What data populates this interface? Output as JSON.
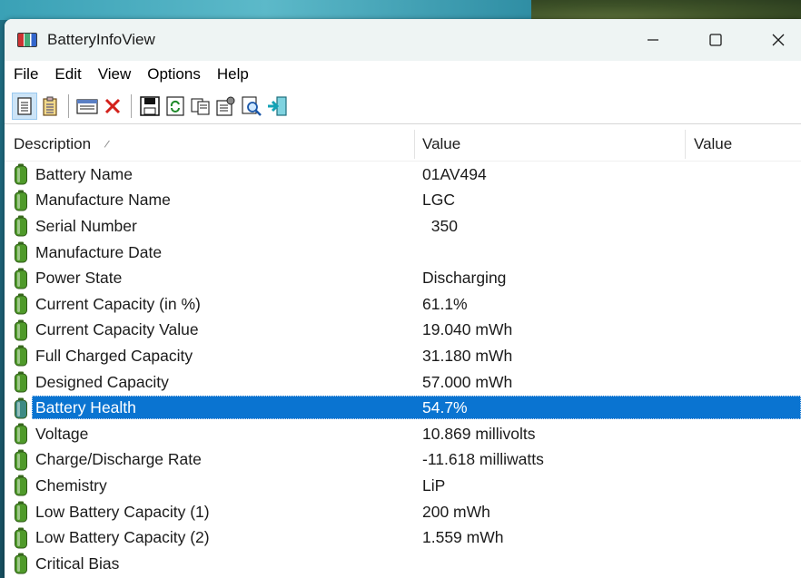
{
  "window": {
    "title": "BatteryInfoView",
    "icons": {
      "app": "battery-app-icon",
      "minimize": "minimize-icon",
      "maximize": "maximize-icon",
      "close": "close-icon"
    }
  },
  "menu": [
    "File",
    "Edit",
    "View",
    "Options",
    "Help"
  ],
  "toolbar": {
    "buttons": [
      "battery-info-mode-icon",
      "battery-log-mode-icon",
      "html-report-icon",
      "delete-icon",
      "save-icon",
      "refresh-icon",
      "copy-icon",
      "properties-icon",
      "find-icon",
      "exit-icon"
    ]
  },
  "columns": {
    "description": "Description",
    "value": "Value",
    "value2": "Value"
  },
  "rows": [
    {
      "description": "Battery Name",
      "value": "01AV494"
    },
    {
      "description": "Manufacture Name",
      "value": "LGC"
    },
    {
      "description": "Serial Number",
      "value": "  350"
    },
    {
      "description": "Manufacture Date",
      "value": ""
    },
    {
      "description": "Power State",
      "value": "Discharging"
    },
    {
      "description": "Current Capacity (in %)",
      "value": "61.1%"
    },
    {
      "description": "Current Capacity Value",
      "value": "19.040 mWh"
    },
    {
      "description": "Full Charged Capacity",
      "value": "31.180 mWh"
    },
    {
      "description": "Designed Capacity",
      "value": "57.000 mWh"
    },
    {
      "description": "Battery Health",
      "value": "54.7%",
      "selected": true
    },
    {
      "description": "Voltage",
      "value": "10.869 millivolts"
    },
    {
      "description": "Charge/Discharge Rate",
      "value": "-11.618 milliwatts"
    },
    {
      "description": "Chemistry",
      "value": "LiP"
    },
    {
      "description": "Low Battery Capacity (1)",
      "value": "200 mWh"
    },
    {
      "description": "Low Battery Capacity (2)",
      "value": "1.559 mWh"
    },
    {
      "description": "Critical Bias",
      "value": ""
    }
  ],
  "colors": {
    "selection": "#0a74d1",
    "battery_green": "#4f9a2a",
    "titlebar": "#eef4f3"
  }
}
